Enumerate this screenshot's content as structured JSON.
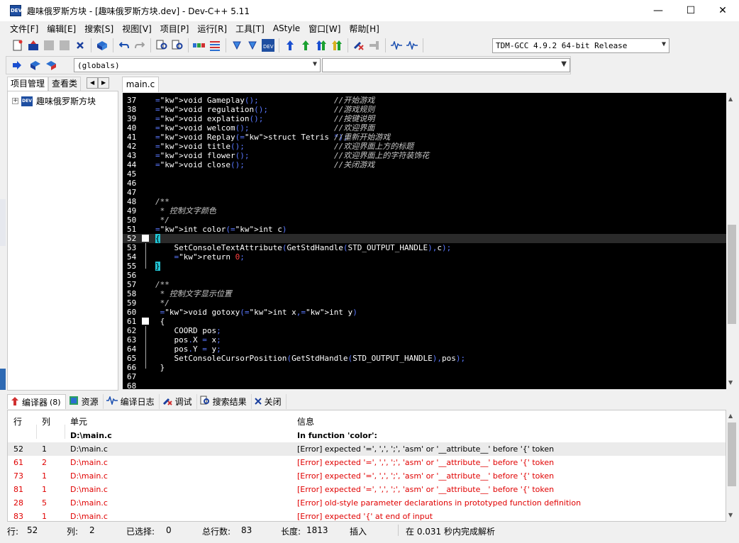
{
  "window": {
    "title": "趣味俄罗斯方块 - [趣味俄罗斯方块.dev] - Dev-C++ 5.11",
    "app_icon_text": "DEV",
    "minimize": "—",
    "maximize": "☐",
    "close": "✕"
  },
  "menu": [
    "文件[F]",
    "编辑[E]",
    "搜索[S]",
    "视图[V]",
    "项目[P]",
    "运行[R]",
    "工具[T]",
    "AStyle",
    "窗口[W]",
    "帮助[H]"
  ],
  "toolbar": {
    "compiler": "TDM-GCC 4.9.2 64-bit Release",
    "scope": "(globals)"
  },
  "left_panel": {
    "tabs": [
      "项目管理",
      "查看类"
    ],
    "nav_prev": "◀",
    "nav_next": "▶",
    "project_name": "趣味俄罗斯方块",
    "project_icon_text": "DEV",
    "expand": "+"
  },
  "editor": {
    "file_tab": "main.c",
    "lines": [
      {
        "n": "37",
        "code": "void Gameplay();",
        "comment": "//开始游戏"
      },
      {
        "n": "38",
        "code": "void regulation();",
        "comment": "//游戏规则"
      },
      {
        "n": "39",
        "code": "void explation();",
        "comment": "//按键说明"
      },
      {
        "n": "40",
        "code": "void welcom();",
        "comment": "//欢迎界面"
      },
      {
        "n": "41",
        "code": "void Replay(struct Tetris *);",
        "comment": "//重新开始游戏"
      },
      {
        "n": "42",
        "code": "void title();",
        "comment": "//欢迎界面上方的标题"
      },
      {
        "n": "43",
        "code": "void flower();",
        "comment": "//欢迎界面上的字符装饰花"
      },
      {
        "n": "44",
        "code": "void close();",
        "comment": "//关闭游戏"
      },
      {
        "n": "45",
        "code": "",
        "comment": ""
      },
      {
        "n": "46",
        "code": "",
        "comment": ""
      },
      {
        "n": "47",
        "code": "",
        "comment": ""
      },
      {
        "n": "48",
        "code": "/**",
        "comment": ""
      },
      {
        "n": "49",
        "code": " * 控制文字颜色",
        "comment": ""
      },
      {
        "n": "50",
        "code": " */",
        "comment": ""
      },
      {
        "n": "51",
        "code": "int color(int c)",
        "comment": ""
      },
      {
        "n": "52",
        "code": "{",
        "comment": ""
      },
      {
        "n": "53",
        "code": "    SetConsoleTextAttribute(GetStdHandle(STD_OUTPUT_HANDLE),c);",
        "comment": ""
      },
      {
        "n": "54",
        "code": "    return 0;",
        "comment": ""
      },
      {
        "n": "55",
        "code": "}",
        "comment": ""
      },
      {
        "n": "56",
        "code": "",
        "comment": ""
      },
      {
        "n": "57",
        "code": "/**",
        "comment": ""
      },
      {
        "n": "58",
        "code": " * 控制文字显示位置",
        "comment": ""
      },
      {
        "n": "59",
        "code": " */",
        "comment": ""
      },
      {
        "n": "60",
        "code": " void gotoxy(int x,int y)",
        "comment": ""
      },
      {
        "n": "61",
        "code": " {",
        "comment": ""
      },
      {
        "n": "62",
        "code": "    COORD pos;",
        "comment": ""
      },
      {
        "n": "63",
        "code": "    pos.X = x;",
        "comment": ""
      },
      {
        "n": "64",
        "code": "    pos.Y = y;",
        "comment": ""
      },
      {
        "n": "65",
        "code": "    SetConsoleCursorPosition(GetStdHandle(STD_OUTPUT_HANDLE),pos);",
        "comment": ""
      },
      {
        "n": "66",
        "code": " }",
        "comment": ""
      },
      {
        "n": "67",
        "code": "",
        "comment": ""
      },
      {
        "n": "68",
        "code": "",
        "comment": ""
      }
    ]
  },
  "bottom_tabs": [
    {
      "label": "编译器",
      "count": "(8)",
      "icon": "compiler-icon"
    },
    {
      "label": "资源",
      "count": "",
      "icon": "resource-icon"
    },
    {
      "label": "编译日志",
      "count": "",
      "icon": "log-icon"
    },
    {
      "label": "调试",
      "count": "",
      "icon": "debug-icon"
    },
    {
      "label": "搜索结果",
      "count": "",
      "icon": "search-results-icon"
    },
    {
      "label": "关闭",
      "count": "",
      "icon": "close-icon"
    }
  ],
  "messages": {
    "headers": {
      "line": "行",
      "col": "列",
      "unit": "单元",
      "message": "信息"
    },
    "rows": [
      {
        "line": "",
        "col": "",
        "unit": "D:\\main.c",
        "message": "In function 'color':",
        "type": "header"
      },
      {
        "line": "52",
        "col": "1",
        "unit": "D:\\main.c",
        "message": "[Error] expected '=', ',', ';', 'asm' or '__attribute__' before '{' token",
        "type": "selected"
      },
      {
        "line": "61",
        "col": "2",
        "unit": "D:\\main.c",
        "message": "[Error] expected '=', ',', ';', 'asm' or '__attribute__' before '{' token",
        "type": "error"
      },
      {
        "line": "73",
        "col": "1",
        "unit": "D:\\main.c",
        "message": "[Error] expected '=', ',', ';', 'asm' or '__attribute__' before '{' token",
        "type": "error"
      },
      {
        "line": "81",
        "col": "1",
        "unit": "D:\\main.c",
        "message": "[Error] expected '=', ',', ';', 'asm' or '__attribute__' before '{' token",
        "type": "error"
      },
      {
        "line": "28",
        "col": "5",
        "unit": "D:\\main.c",
        "message": "[Error] old-style parameter declarations in prototyped function definition",
        "type": "error"
      },
      {
        "line": "83",
        "col": "1",
        "unit": "D:\\main.c",
        "message": "[Error] expected '{' at end of input",
        "type": "error"
      }
    ]
  },
  "status": {
    "line_label": "行:",
    "line_value": "52",
    "col_label": "列:",
    "col_value": "2",
    "sel_label": "已选择:",
    "sel_value": "0",
    "total_label": "总行数:",
    "total_value": "83",
    "len_label": "长度:",
    "len_value": "1813",
    "mode": "插入",
    "parse": "在 0.031 秒内完成解析"
  },
  "colors": {
    "editor_bg": "#000000",
    "keyword": "#9aa7ff",
    "comment": "#c8c8c8",
    "number": "#ff4040",
    "error_text": "#e00000",
    "brace_highlight": "#22c4d4"
  }
}
